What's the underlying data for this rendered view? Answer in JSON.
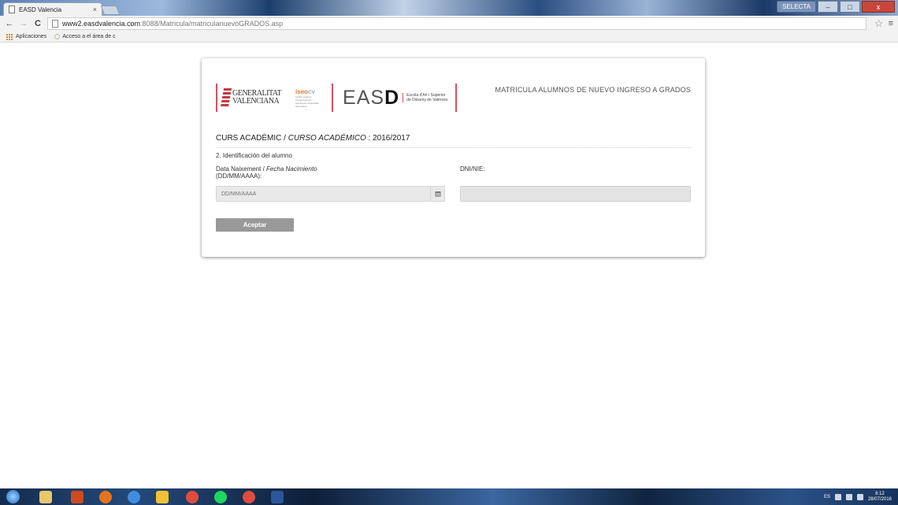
{
  "browser": {
    "tab_title": "EASD Valencia",
    "tab_close": "×",
    "url_host": "www2.easdvalencia.com",
    "url_path": ":8088/Matricula/matriculanuevoGRADOS.asp",
    "bookmarks": [
      "Aplicaciones",
      "Acceso a el área de c"
    ],
    "window_user": "SELECTA",
    "minimize": "–",
    "maximize": "□",
    "close": "x"
  },
  "logos": {
    "generalitat": "GENERALITAT",
    "valenciana": "VALENCIANA",
    "iseo_a": "iseo",
    "iseo_b": "cv",
    "iseo_sub": "Institut superior d'ensenyances artístiques Generalitat Valenciana",
    "easd_main": "EAS",
    "easd_bold": "D",
    "easd_sub1": "Escola d'Art i Superior",
    "easd_sub2": "de Disseny de València"
  },
  "header": {
    "title": "MATRICULA ALUMNOS DE NUEVO INGRESO A GRADOS"
  },
  "course": {
    "label_va": "CURS ACADÈMIC / ",
    "label_es": "CURSO ACADÉMICO",
    "separator": " : ",
    "value": "2016/2017"
  },
  "form": {
    "section_title": "2. Identificación del alumno",
    "date_label_va": "Data Naixement / ",
    "date_label_es": "Fecha Nacimiento",
    "date_label_fmt": "(DD/MM/AAAA):",
    "date_placeholder": "DD/MM/AAAA",
    "date_value": "",
    "dni_label": "DNI/NIE:",
    "dni_value": "",
    "accept_label": "Aceptar"
  },
  "taskbar": {
    "lang": "ES",
    "time": "8:12",
    "date": "28/07/2016"
  },
  "colors": {
    "accent_red": "#d6515e",
    "button_gray": "#999999"
  }
}
